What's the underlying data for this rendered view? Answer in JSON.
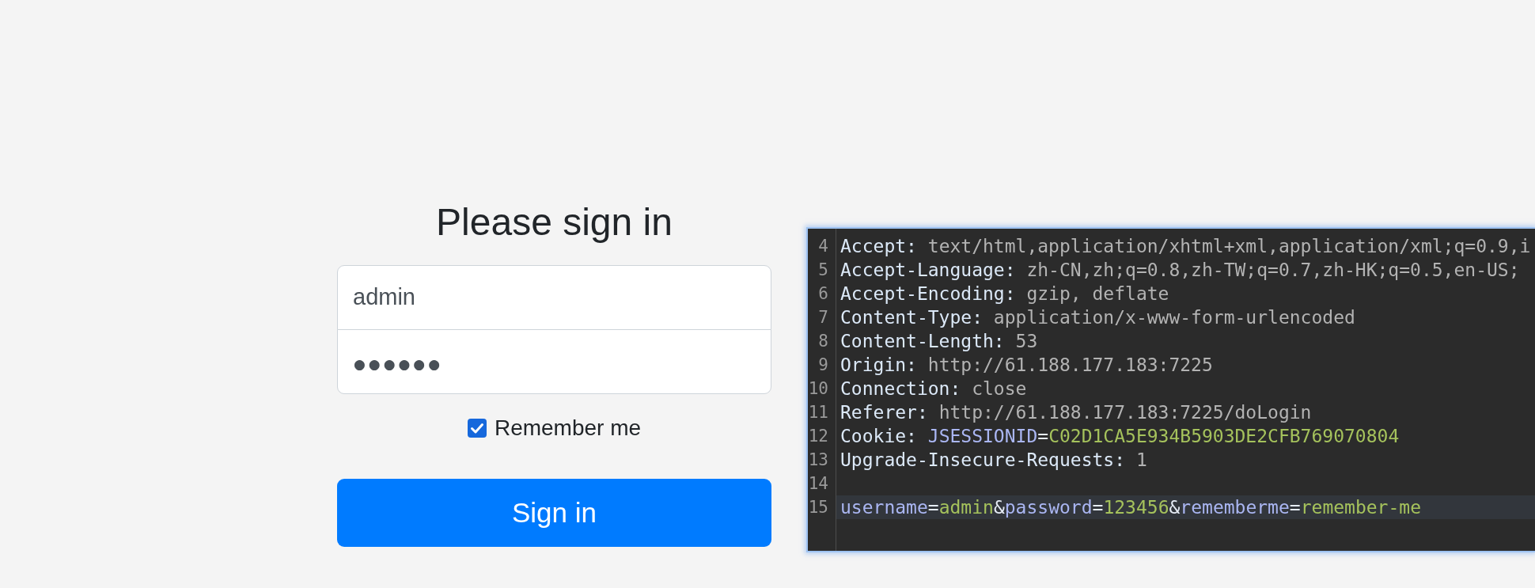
{
  "login_form": {
    "heading": "Please sign in",
    "username_field": {
      "value": "admin"
    },
    "password_field": {
      "value": "●●●●●●"
    },
    "remember_me": {
      "label": "Remember me",
      "checked": true
    },
    "submit_button": {
      "label": "Sign in"
    }
  },
  "request_editor": {
    "lines": [
      {
        "number": "4",
        "highlighted": false,
        "segments": [
          {
            "kind": "name",
            "text": "Accept:"
          },
          {
            "kind": "value",
            "text": " text/html,application/xhtml+xml,application/xml;q=0.9,i"
          }
        ]
      },
      {
        "number": "5",
        "highlighted": false,
        "segments": [
          {
            "kind": "name",
            "text": "Accept-Language:"
          },
          {
            "kind": "value",
            "text": " zh-CN,zh;q=0.8,zh-TW;q=0.7,zh-HK;q=0.5,en-US;"
          }
        ]
      },
      {
        "number": "6",
        "highlighted": false,
        "segments": [
          {
            "kind": "name",
            "text": "Accept-Encoding:"
          },
          {
            "kind": "value",
            "text": " gzip, deflate"
          }
        ]
      },
      {
        "number": "7",
        "highlighted": false,
        "segments": [
          {
            "kind": "name",
            "text": "Content-Type:"
          },
          {
            "kind": "value",
            "text": " application/x-www-form-urlencoded"
          }
        ]
      },
      {
        "number": "8",
        "highlighted": false,
        "segments": [
          {
            "kind": "name",
            "text": "Content-Length:"
          },
          {
            "kind": "value",
            "text": " 53"
          }
        ]
      },
      {
        "number": "9",
        "highlighted": false,
        "segments": [
          {
            "kind": "name",
            "text": "Origin:"
          },
          {
            "kind": "value",
            "text": " http://61.188.177.183:7225"
          }
        ]
      },
      {
        "number": "10",
        "highlighted": false,
        "segments": [
          {
            "kind": "name",
            "text": "Connection:"
          },
          {
            "kind": "value",
            "text": " close"
          }
        ]
      },
      {
        "number": "11",
        "highlighted": false,
        "segments": [
          {
            "kind": "name",
            "text": "Referer:"
          },
          {
            "kind": "value",
            "text": " http://61.188.177.183:7225/doLogin"
          }
        ]
      },
      {
        "number": "12",
        "highlighted": false,
        "segments": [
          {
            "kind": "name",
            "text": "Cookie:"
          },
          {
            "kind": "key",
            "text": " JSESSIONID"
          },
          {
            "kind": "sep",
            "text": "="
          },
          {
            "kind": "data",
            "text": "C02D1CA5E934B5903DE2CFB769070804"
          }
        ]
      },
      {
        "number": "13",
        "highlighted": false,
        "segments": [
          {
            "kind": "name",
            "text": "Upgrade-Insecure-Requests:"
          },
          {
            "kind": "value",
            "text": " 1"
          }
        ]
      },
      {
        "number": "14",
        "highlighted": false
      },
      {
        "number": "15",
        "highlighted": true,
        "segments": [
          {
            "kind": "key",
            "text": "username"
          },
          {
            "kind": "sep",
            "text": "="
          },
          {
            "kind": "data",
            "text": "admin"
          },
          {
            "kind": "sep",
            "text": "&"
          },
          {
            "kind": "key",
            "text": "password"
          },
          {
            "kind": "sep",
            "text": "="
          },
          {
            "kind": "data",
            "text": "123456"
          },
          {
            "kind": "sep",
            "text": "&"
          },
          {
            "kind": "key",
            "text": "rememberme"
          },
          {
            "kind": "sep",
            "text": "="
          },
          {
            "kind": "data",
            "text": "remember-me"
          }
        ]
      }
    ]
  }
}
